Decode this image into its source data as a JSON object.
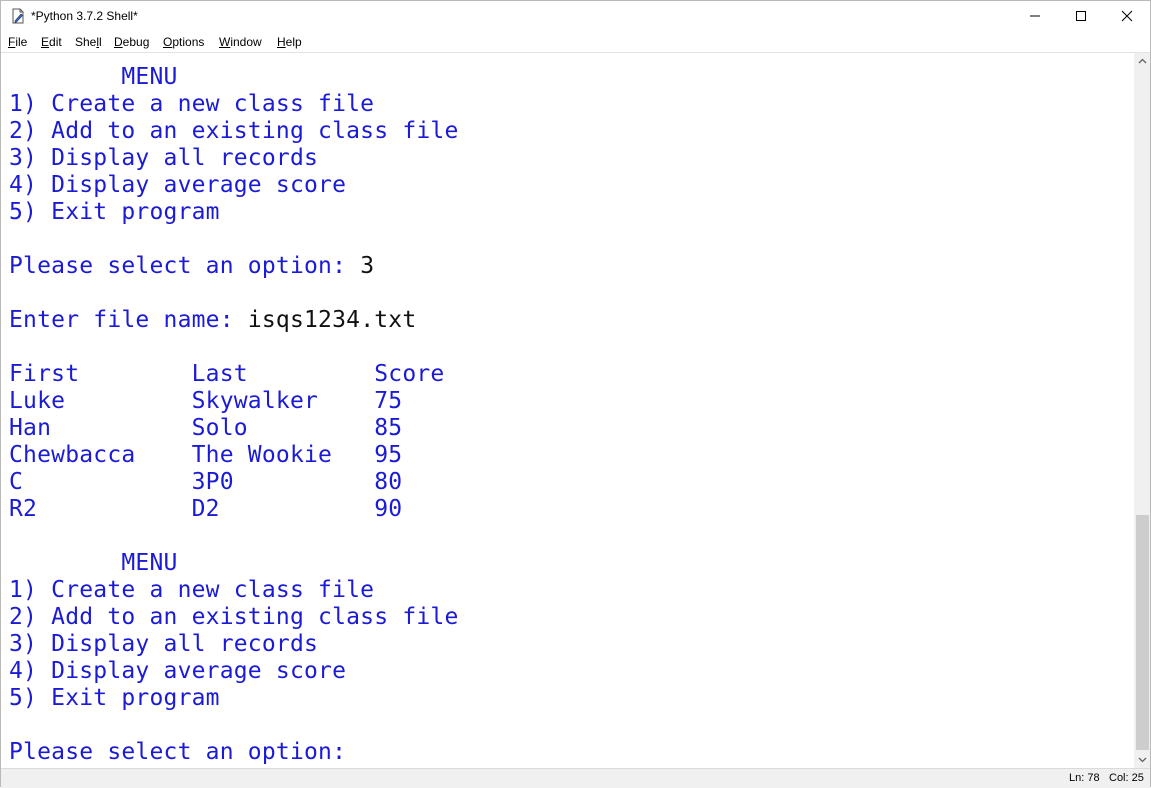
{
  "window": {
    "title": "*Python 3.7.2 Shell*",
    "controls": {
      "minimize_icon": "minimize-icon",
      "maximize_icon": "maximize-icon",
      "close_icon": "close-icon"
    }
  },
  "menubar": {
    "items": [
      {
        "mnemonic": "F",
        "rest": "ile"
      },
      {
        "mnemonic": "E",
        "rest": "dit"
      },
      {
        "pre": "She",
        "mnemonic": "l",
        "rest": "l"
      },
      {
        "mnemonic": "D",
        "rest": "ebug"
      },
      {
        "mnemonic": "O",
        "rest": "ptions"
      },
      {
        "mnemonic": "W",
        "rest": "indow"
      },
      {
        "mnemonic": "H",
        "rest": "elp"
      }
    ]
  },
  "shell": {
    "menu1": {
      "title": "        MENU",
      "opt1": "1) Create a new class file",
      "opt2": "2) Add to an existing class file",
      "opt3": "3) Display all records",
      "opt4": "4) Display average score",
      "opt5": "5) Exit program"
    },
    "select_prompt_1": "Please select an option: ",
    "select_input_1": "3",
    "file_prompt": "Enter file name: ",
    "file_input": "isqs1234.txt",
    "table": {
      "header": "First        Last         Score",
      "rows": [
        "Luke         Skywalker    75",
        "Han          Solo         85",
        "Chewbacca    The Wookie   95",
        "C            3P0          80",
        "R2           D2           90"
      ]
    },
    "menu2": {
      "title": "        MENU",
      "opt1": "1) Create a new class file",
      "opt2": "2) Add to an existing class file",
      "opt3": "3) Display all records",
      "opt4": "4) Display average score",
      "opt5": "5) Exit program"
    },
    "select_prompt_2": "Please select an option: "
  },
  "status": {
    "ln": "Ln: 78",
    "col": "Col: 25"
  },
  "colors": {
    "prompt": "#1b1bd6",
    "input": "#111111",
    "thumb": "#cdcdcd"
  },
  "scroll": {
    "position_fraction": 0.66
  }
}
